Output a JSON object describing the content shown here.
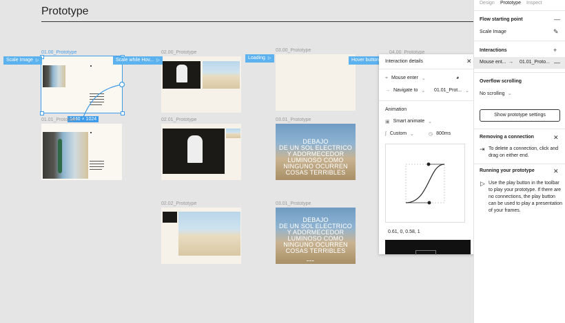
{
  "page": {
    "title": "Prototype"
  },
  "frames": {
    "f0100": {
      "label": "01.00_Prototype"
    },
    "f0101": {
      "label": "01.01_Prototype"
    },
    "f0200": {
      "label": "02.00_Prototype"
    },
    "f0201": {
      "label": "02.01_Prototype"
    },
    "f0202": {
      "label": "02.02_Prototype"
    },
    "f0300": {
      "label": "03.00_Prototype"
    },
    "f0301a": {
      "label": "03.01_Prototype"
    },
    "f0301b": {
      "label": "03.01_Prototype"
    },
    "f0400": {
      "label": "04.00_Prototype"
    }
  },
  "selection": {
    "dimensions": "1440 × 1024"
  },
  "connection_tags": {
    "scale_image": "Scale Image",
    "scale_hover": "Scale while Hov...",
    "loading": "Loading",
    "hover_button": "Hover button"
  },
  "poster_text": "DEBAJO\nDE UN SOL ELECTRICO\nY ADORMECEDOR\nLUMINOSO COMO\nNINGUNO OCURREN\nCOSAS TERRIBLES",
  "popup": {
    "title": "Interaction details",
    "trigger": "Mouse enter",
    "action": "Navigate to",
    "destination": "01.01_Prot...",
    "animation_label": "Animation",
    "animation_type": "Smart animate",
    "easing": "Custom",
    "duration": "800ms",
    "bezier": "0.61, 0, 0.58, 1"
  },
  "panel": {
    "tabs": [
      "Design",
      "Prototype",
      "Inspect"
    ],
    "flow_title": "Flow starting point",
    "flow_name": "Scale Image",
    "interactions_title": "Interactions",
    "interaction_trigger": "Mouse ent...",
    "interaction_target": "01.01_Proto...",
    "overflow_title": "Overflow scrolling",
    "overflow_value": "No scrolling",
    "show_settings": "Show prototype settings",
    "removing_title": "Removing a connection",
    "removing_text": "To delete a connection, click and drag on either end.",
    "running_title": "Running your prototype",
    "running_text": "Use the play button in the toolbar to play your prototype. If there are no connections, the play button can be used to play a presentation of your frames."
  },
  "colors": {
    "selection": "#3d9be9",
    "tag": "#5cb1ef",
    "canvas": "#e5e5e5"
  }
}
